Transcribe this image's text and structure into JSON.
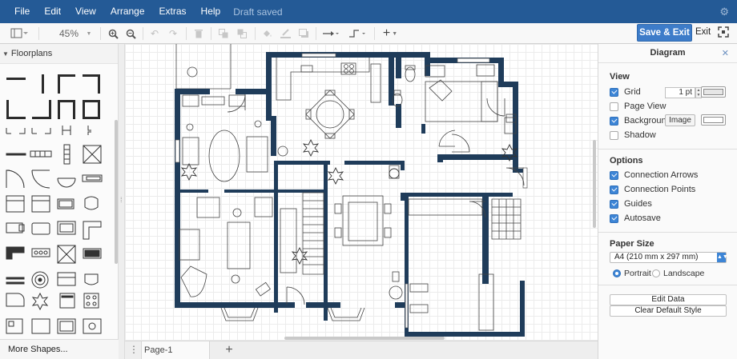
{
  "menubar": {
    "items": [
      "File",
      "Edit",
      "View",
      "Arrange",
      "Extras",
      "Help"
    ],
    "status": "Draft saved"
  },
  "toolbar": {
    "zoom": "45%",
    "save_exit": "Save & Exit",
    "exit": "Exit"
  },
  "sidebar": {
    "section": "Floorplans",
    "more_shapes": "More Shapes..."
  },
  "pages": {
    "current": "Page-1"
  },
  "panel": {
    "title": "Diagram",
    "view": {
      "title": "View",
      "grid_label": "Grid",
      "grid_checked": true,
      "grid_size": "1 pt",
      "page_view_label": "Page View",
      "page_view_checked": false,
      "background_label": "Background",
      "background_checked": true,
      "image_button": "Image",
      "shadow_label": "Shadow",
      "shadow_checked": false
    },
    "options": {
      "title": "Options",
      "connection_arrows": "Connection Arrows",
      "connection_points": "Connection Points",
      "guides": "Guides",
      "autosave": "Autosave"
    },
    "paper": {
      "title": "Paper Size",
      "size": "A4 (210 mm x 297 mm)",
      "portrait": "Portrait",
      "landscape": "Landscape",
      "orientation": "portrait"
    },
    "buttons": {
      "edit_data": "Edit Data",
      "clear_style": "Clear Default Style"
    }
  },
  "colors": {
    "menubar": "#245a96",
    "accent": "#3d85d6",
    "wall": "#1f3c5a",
    "grid_swatch": "#e6e6e6",
    "background_swatch": "#ffffff"
  },
  "icons": [
    "format-panel-icon",
    "zoom-in-icon",
    "zoom-out-icon",
    "undo-icon",
    "redo-icon",
    "delete-icon",
    "to-front-icon",
    "to-back-icon",
    "fill-color-icon",
    "line-color-icon",
    "shadow-icon",
    "connection-icon",
    "waypoints-icon",
    "insert-icon",
    "fullscreen-icon",
    "gear-icon",
    "close-icon"
  ]
}
